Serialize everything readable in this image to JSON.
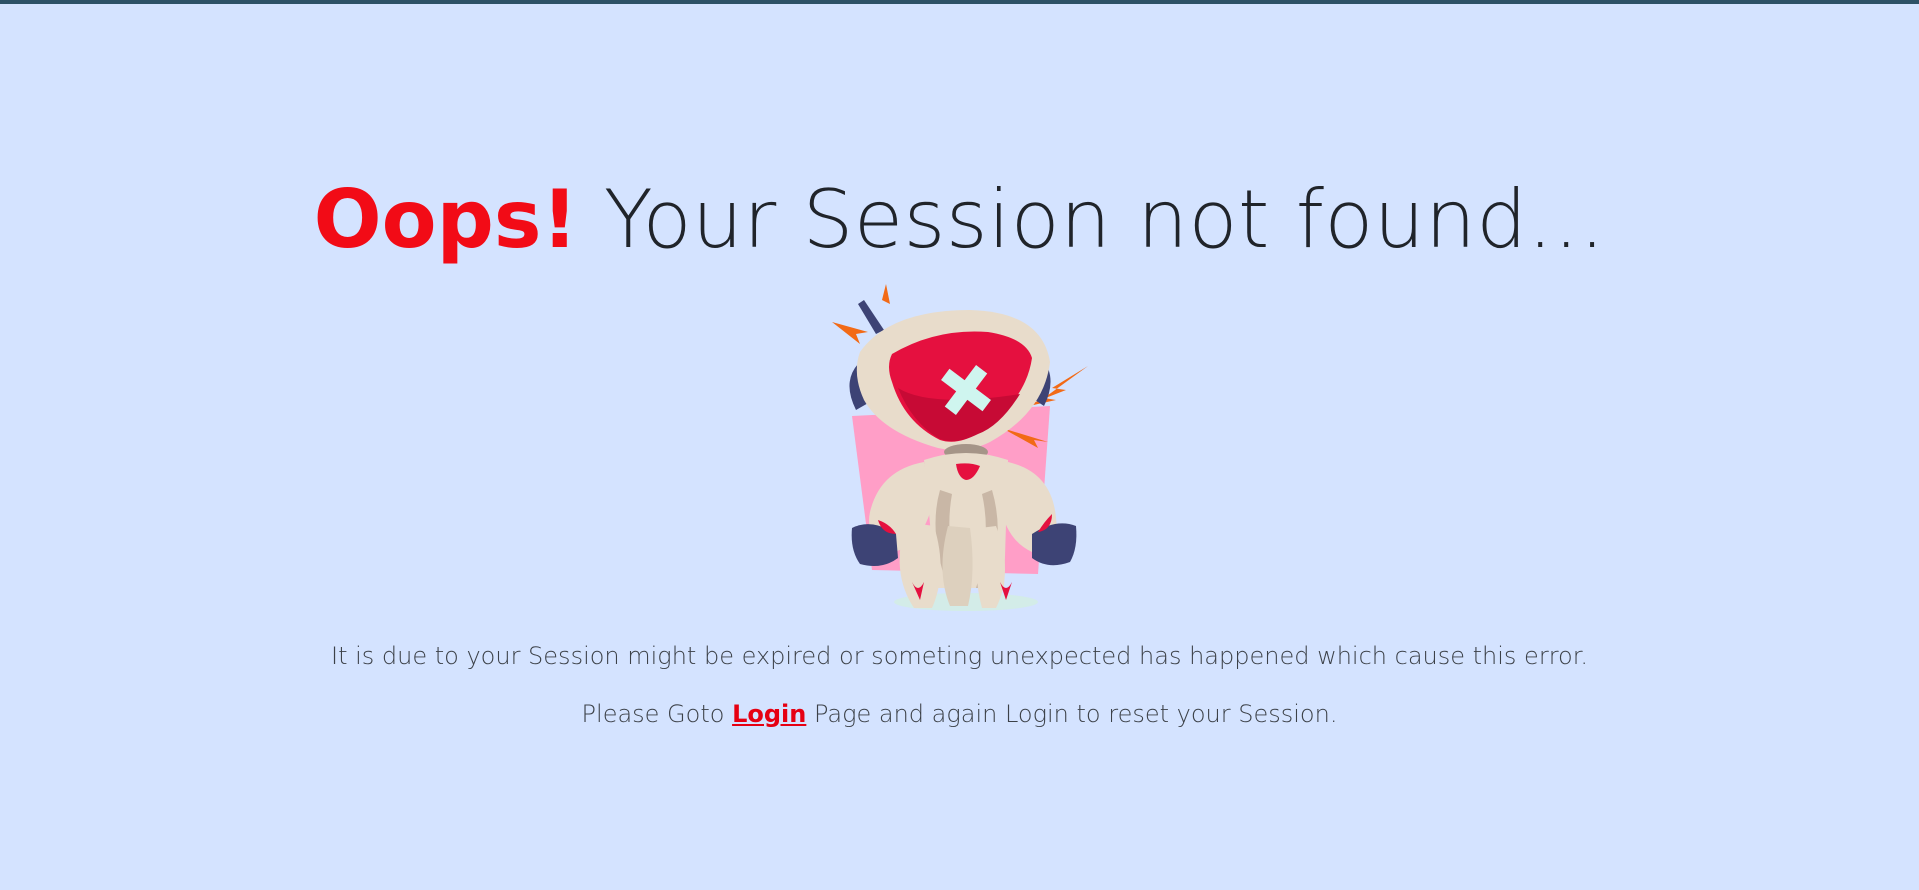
{
  "headline": {
    "exclaim": "Oops!",
    "rest": " Your Session not found..."
  },
  "illustration": {
    "icon": "broken-robot-icon",
    "colors": {
      "backdrop": "#ff9ec7",
      "visor": "#e5103f",
      "body": "#e8dccb",
      "joints": "#3d4375",
      "sparks": "#f26a16",
      "cross": "#cff5ef"
    }
  },
  "message": {
    "line1": "It is due to your Session might be expired or someting unexpected has happened which cause this error.",
    "line2_prefix": "Please Goto ",
    "login_link": "Login",
    "line2_suffix": " Page and again Login to reset your Session."
  },
  "colors": {
    "background": "#d4e3ff",
    "accent": "#f20b16",
    "top_bar": "#2d5166"
  }
}
